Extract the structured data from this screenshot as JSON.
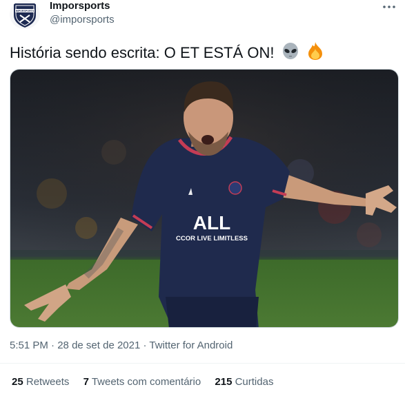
{
  "author": {
    "display_name": "Imporsports",
    "handle": "@imporsports",
    "avatar_text": "IMPORSPORTS"
  },
  "more_icon": "more-horizontal-icon",
  "tweet": {
    "text": "História sendo escrita: O ET ESTÁ ON!",
    "emojis": [
      "alien-emoji",
      "fire-emoji"
    ]
  },
  "media": {
    "description_icon": "photo",
    "shirt_text_line1": "ALL",
    "shirt_text_line2": "CCOR LIVE LIMITLESS"
  },
  "meta": {
    "time": "5:51 PM",
    "date": "28 de set de 2021",
    "source": "Twitter for Android",
    "separator": "·"
  },
  "stats": {
    "retweets_count": "25",
    "retweets_label": "Retweets",
    "quotes_count": "7",
    "quotes_label": "Tweets com comentário",
    "likes_count": "215",
    "likes_label": "Curtidas"
  },
  "colors": {
    "secondary_text": "#536471",
    "primary_text": "#0f1419",
    "divider": "#eff3f4",
    "shirt_navy": "#1f2a4d",
    "pitch_green": "#4c7a33"
  }
}
